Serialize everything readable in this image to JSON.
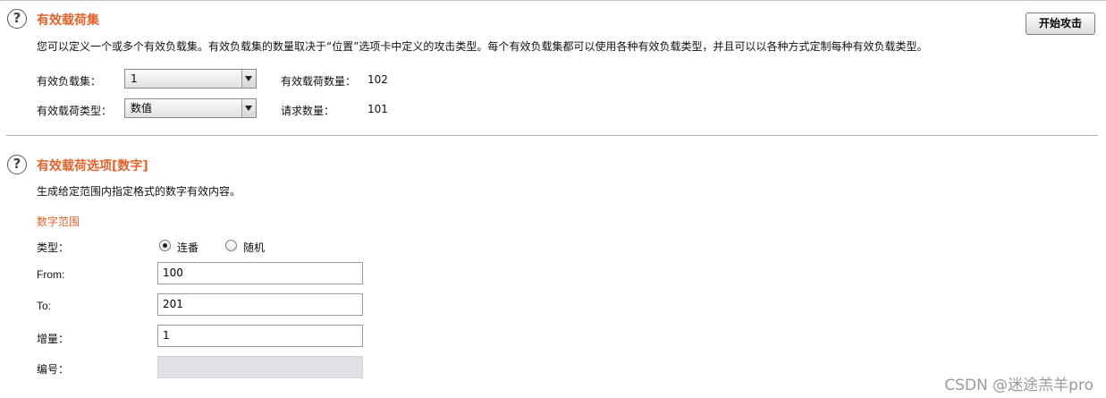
{
  "payload_sets": {
    "title": "有效载荷集",
    "description": "您可以定义一个或多个有效负载集。有效负载集的数量取决于“位置”选项卡中定义的攻击类型。每个有效负载集都可以使用各种有效负载类型，并且可以以各种方式定制每种有效负载类型。",
    "start_attack_label": "开始攻击",
    "set_label": "有效负载集：",
    "set_value": "1",
    "type_label": "有效载荷类型：",
    "type_value": "数值",
    "count_label": "有效载荷数量：",
    "count_value": "102",
    "request_label": "请求数量：",
    "request_value": "101"
  },
  "payload_options": {
    "title": "有效载荷选项[数字]",
    "description": "生成给定范围内指定格式的数字有效内容。",
    "range_title": "数字范围",
    "type_label": "类型：",
    "radio_sequential": "连番",
    "radio_random": "随机",
    "from_label": "From:",
    "from_value": "100",
    "to_label": "To:",
    "to_value": "201",
    "step_label": "增量：",
    "step_value": "1",
    "number_label": "编号：",
    "number_value": ""
  },
  "watermark": "CSDN @迷途羔羊pro",
  "colors": {
    "accent": "#e2632d"
  }
}
